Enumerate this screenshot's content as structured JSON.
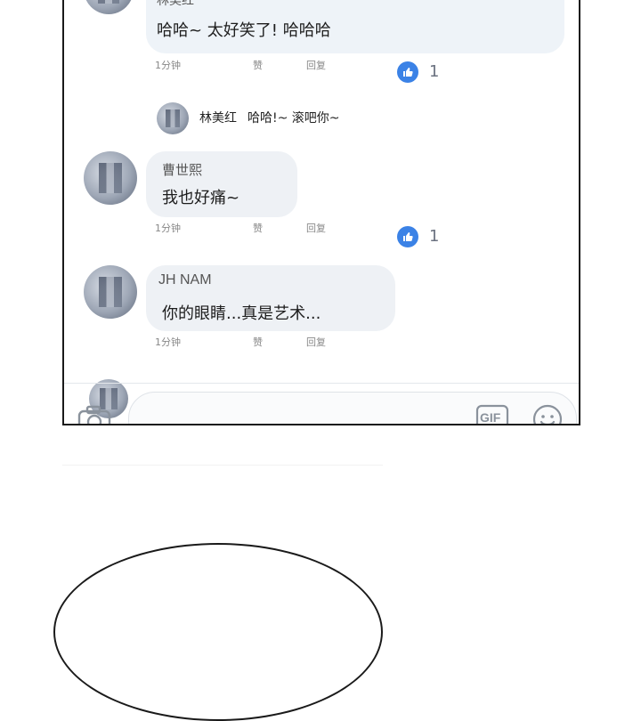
{
  "comments": [
    {
      "name": "林美红",
      "text": "哈哈~ 太好笑了! 哈哈哈",
      "time": "1分钟",
      "like_label": "赞",
      "reply_label": "回复",
      "like_count": "1"
    },
    {
      "name": "曹世熙",
      "text": "我也好痛~",
      "time": "1分钟",
      "like_label": "赞",
      "reply_label": "回复",
      "like_count": "1"
    },
    {
      "name": "JH NAM",
      "text": "你的眼睛...真是艺术...",
      "time": "1分钟",
      "like_label": "赞",
      "reply_label": "回复"
    }
  ],
  "reply_preview": {
    "name": "林美红",
    "text": "哈哈!~ 滚吧你~"
  },
  "composer": {
    "gif_label": "GIF"
  },
  "colors": {
    "like_blue": "#3b82e6",
    "bubble_bg": "#eef1f5"
  }
}
